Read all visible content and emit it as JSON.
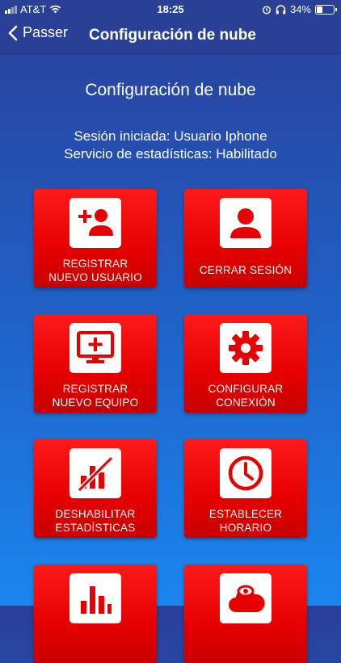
{
  "status": {
    "carrier": "AT&T",
    "time": "18:25",
    "battery": "34%",
    "battery_level": 0.34
  },
  "nav": {
    "back_label": "Passer",
    "title": "Configuración de nube"
  },
  "page": {
    "title": "Configuración de nube",
    "session_line": "Sesión iniciada: Usuario Iphone",
    "stats_line": "Servicio de estadísticas: Habilitado"
  },
  "tiles": [
    {
      "line1": "REGISTRAR",
      "line2": "NUEVO USUARIO",
      "icon": "add-user-icon"
    },
    {
      "line1": "CERRAR SESIÓN",
      "line2": "",
      "icon": "user-icon"
    },
    {
      "line1": "REGISTRAR",
      "line2": "NUEVO EQUIPO",
      "icon": "add-device-icon"
    },
    {
      "line1": "CONFIGURAR",
      "line2": "CONEXIÓN",
      "icon": "gear-icon"
    },
    {
      "line1": "DESHABILITAR",
      "line2": "ESTADÍSTICAS",
      "icon": "disable-stats-icon"
    },
    {
      "line1": "ESTABLECER",
      "line2": "HORARIO",
      "icon": "clock-icon"
    },
    {
      "line1": "",
      "line2": "",
      "icon": "bar-chart-icon"
    },
    {
      "line1": "",
      "line2": "",
      "icon": "cloud-eye-icon"
    }
  ],
  "colors": {
    "tile_red": "#e60000",
    "header_blue": "#2a3f96"
  }
}
